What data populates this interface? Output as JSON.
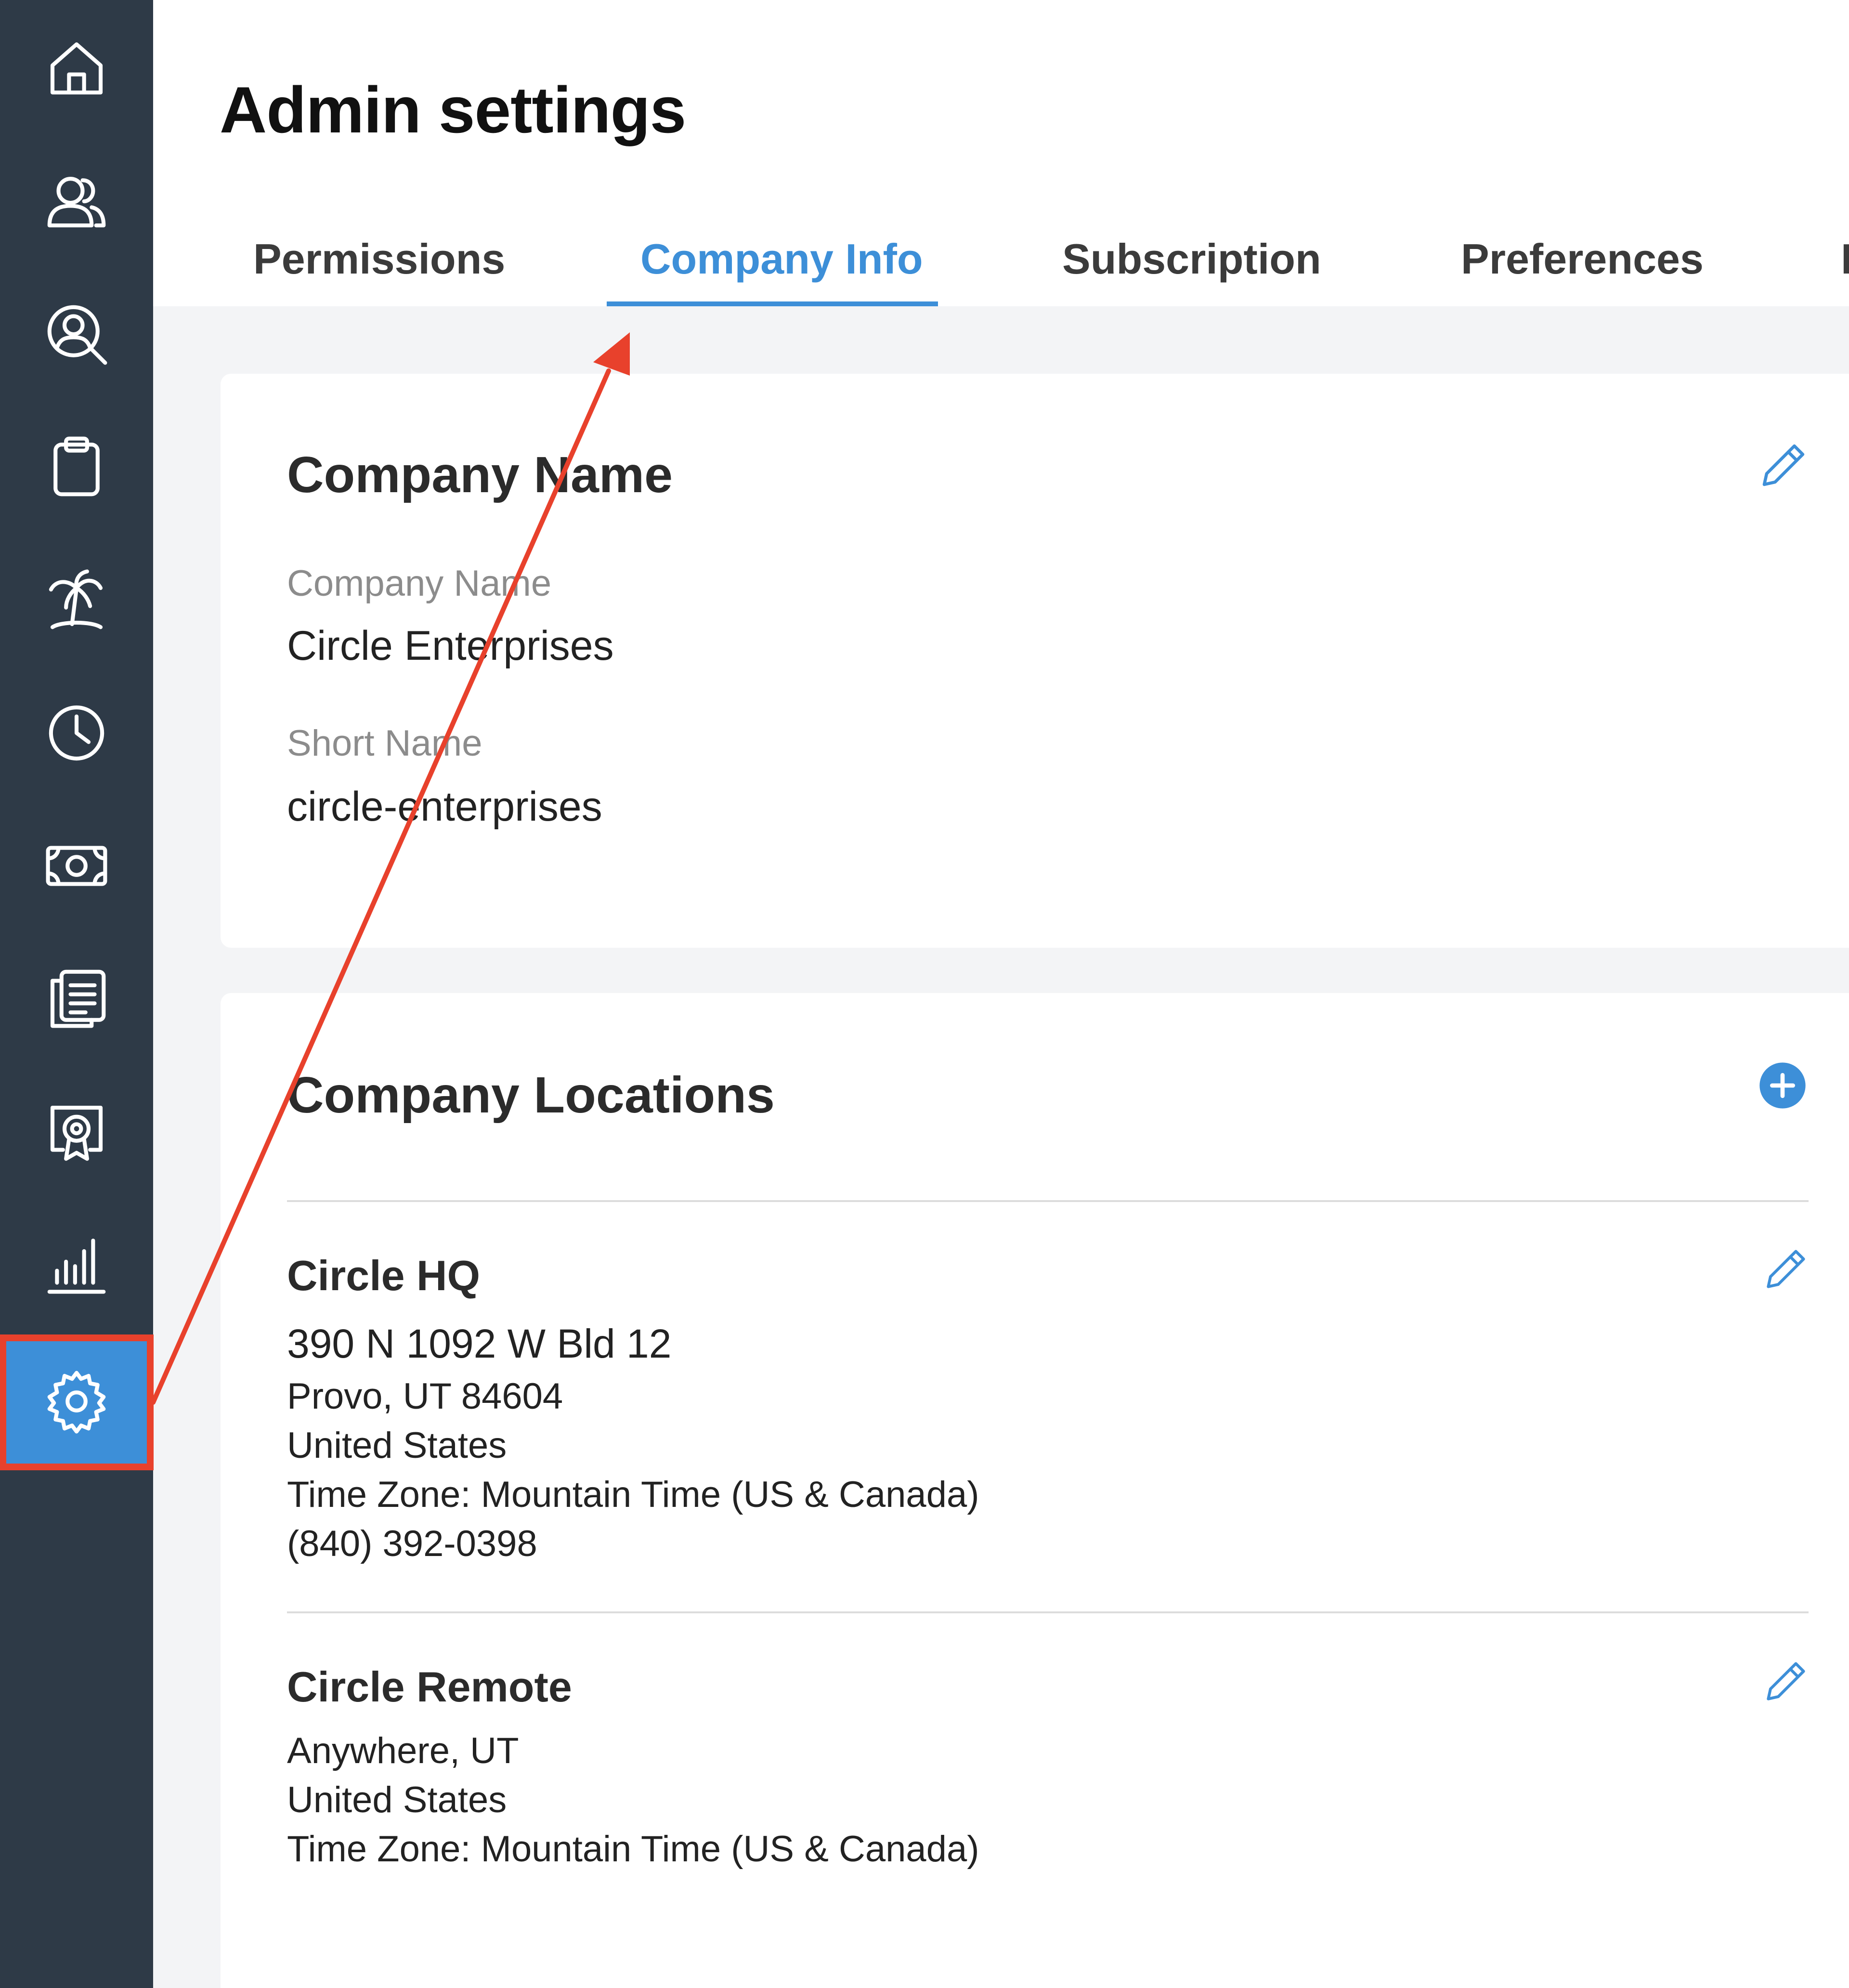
{
  "page": {
    "title": "Admin settings"
  },
  "sidebar": {
    "items": [
      {
        "icon": "home-icon",
        "active": false
      },
      {
        "icon": "users-icon",
        "active": false
      },
      {
        "icon": "user-search-icon",
        "active": false
      },
      {
        "icon": "clipboard-icon",
        "active": false
      },
      {
        "icon": "palm-tree-icon",
        "active": false
      },
      {
        "icon": "clock-icon",
        "active": false
      },
      {
        "icon": "money-icon",
        "active": false
      },
      {
        "icon": "documents-icon",
        "active": false
      },
      {
        "icon": "certificate-icon",
        "active": false
      },
      {
        "icon": "bar-chart-icon",
        "active": false
      },
      {
        "icon": "gear-icon",
        "active": true
      }
    ]
  },
  "tabs": [
    {
      "label": "Permissions",
      "active": false
    },
    {
      "label": "Company Info",
      "active": true
    },
    {
      "label": "Subscription",
      "active": false
    },
    {
      "label": "Preferences",
      "active": false
    },
    {
      "label": "I",
      "active": false
    }
  ],
  "company_name_card": {
    "title": "Company Name",
    "fields": [
      {
        "label": "Company Name",
        "value": "Circle Enterprises"
      },
      {
        "label": "Short Name",
        "value": "circle-enterprises"
      }
    ]
  },
  "locations_card": {
    "title": "Company Locations",
    "locations": [
      {
        "name": "Circle HQ",
        "lines": [
          "390 N 1092 W Bld 12",
          "Provo, UT 84604",
          "United States",
          "Time Zone: Mountain Time (US & Canada)",
          "(840) 392-0398"
        ]
      },
      {
        "name": "Circle Remote",
        "lines": [
          "Anywhere, UT",
          "United States",
          "Time Zone: Mountain Time (US & Canada)"
        ]
      }
    ]
  },
  "colors": {
    "sidebar_bg": "#2e3a47",
    "accent": "#3d8fd8",
    "annotation": "#e8412c"
  }
}
